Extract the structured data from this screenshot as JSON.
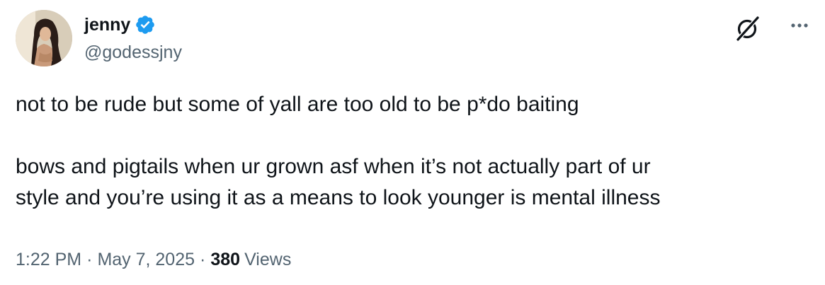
{
  "author": {
    "display_name": "jenny",
    "handle": "@godessjny",
    "verified": true,
    "avatar_icon": "profile-photo"
  },
  "header_actions": {
    "grok_icon": "grok-icon",
    "more_icon": "more-options-icon"
  },
  "tweet": {
    "line1": "not to be rude but some of yall are too old to be p*do baiting",
    "line2": "bows and pigtails when ur grown asf when it’s not actually part of ur",
    "line3": "style and you’re using it as a means to look younger is mental illness"
  },
  "meta": {
    "time": "1:22 PM",
    "separator": "·",
    "date": "May 7, 2025",
    "views_count": "380",
    "views_label": "Views"
  },
  "colors": {
    "text": "#0f1419",
    "secondary": "#536471",
    "verified": "#1d9bf0"
  }
}
